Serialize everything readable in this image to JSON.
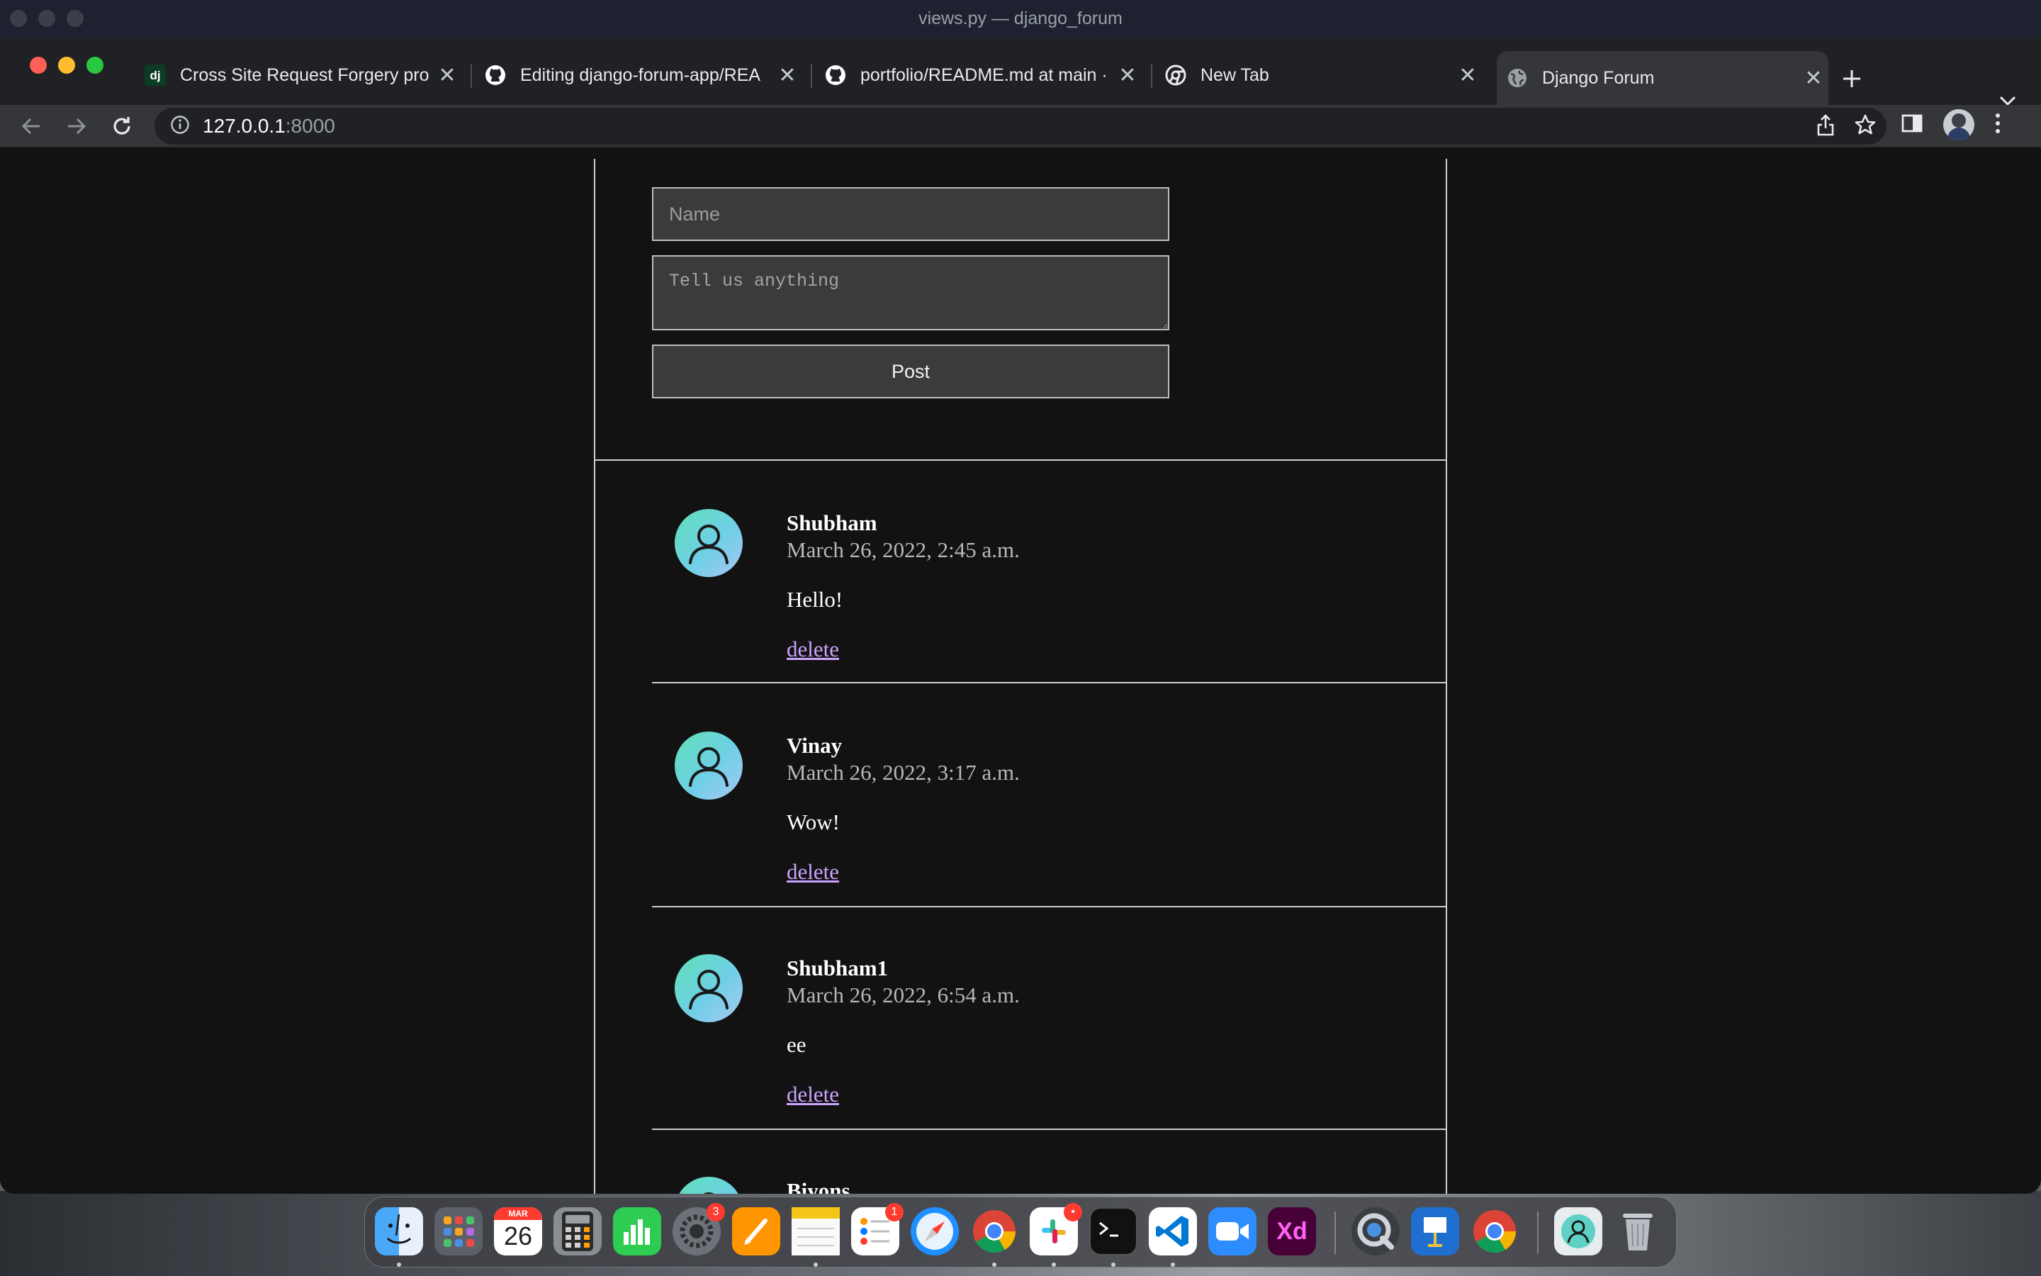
{
  "window": {
    "title": "views.py — django_forum"
  },
  "tabs": [
    {
      "label": "Cross Site Request Forgery pro",
      "icon": "django-icon",
      "active": false
    },
    {
      "label": "Editing django-forum-app/REA",
      "icon": "github-icon",
      "active": false
    },
    {
      "label": "portfolio/README.md at main ·",
      "icon": "github-icon",
      "active": false
    },
    {
      "label": "New Tab",
      "icon": "chrome-icon",
      "active": false
    },
    {
      "label": "Django Forum",
      "icon": "globe-icon",
      "active": true
    }
  ],
  "address_bar": {
    "host": "127.0.0.1",
    "port": ":8000"
  },
  "form": {
    "name_placeholder": "Name",
    "message_placeholder": "Tell us anything",
    "submit_label": "Post"
  },
  "posts": [
    {
      "author": "Shubham",
      "date": "March 26, 2022, 2:45 a.m.",
      "body": "Hello!",
      "delete_label": "delete"
    },
    {
      "author": "Vinay",
      "date": "March 26, 2022, 3:17 a.m.",
      "body": "Wow!",
      "delete_label": "delete"
    },
    {
      "author": "Shubham1",
      "date": "March 26, 2022, 6:54 a.m.",
      "body": "ee",
      "delete_label": "delete"
    },
    {
      "author": "Biyons",
      "date": "",
      "body": "",
      "delete_label": ""
    }
  ],
  "dock": {
    "calendar_month": "MAR",
    "calendar_day": "26",
    "settings_badge": "3",
    "reminders_badge": "1",
    "slack_badge": "•",
    "xd_label": "Xd",
    "dj_label": "dj"
  },
  "colors": {
    "page_bg": "#121212",
    "input_bg": "#3b3b3b",
    "link": "#c9a3ff",
    "avatar_gradient_start": "#5fe0b6",
    "avatar_gradient_end": "#a9c7f2"
  }
}
